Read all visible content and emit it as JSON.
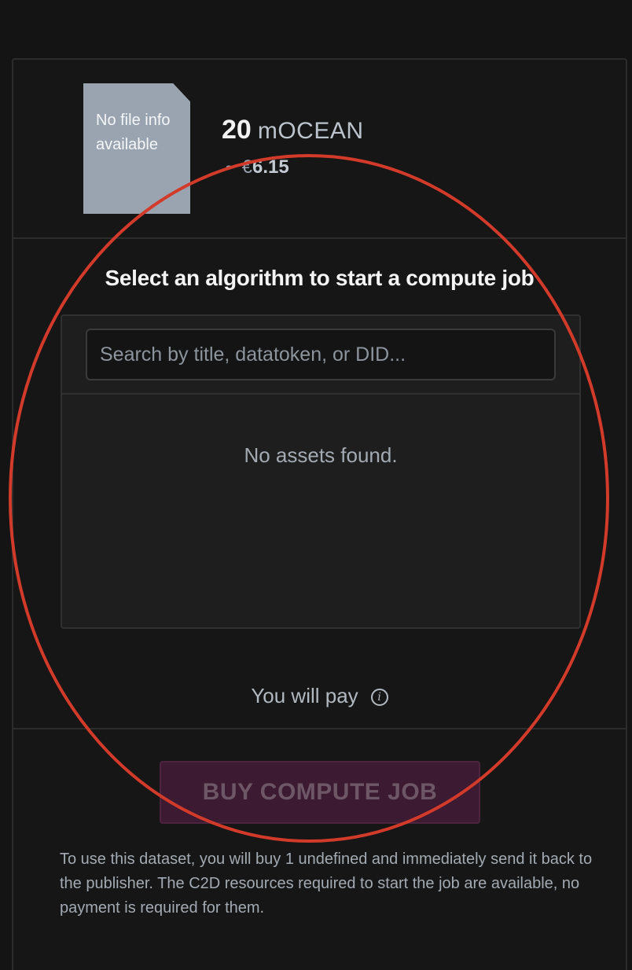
{
  "asset": {
    "file_info": "No file info available",
    "price_amount": "20",
    "price_symbol": "mOCEAN",
    "price_conversion_prefix": "~ €",
    "price_conversion_value": "6.15"
  },
  "compute": {
    "title": "Select an algorithm to start a compute job",
    "search_placeholder": "Search by title, datatoken, or DID...",
    "empty_message": "No assets found.",
    "pay_label": "You will pay",
    "info_icon": "info-icon",
    "buy_button_label": "BUY COMPUTE JOB",
    "disclaimer": "To use this dataset, you will buy 1 undefined and immediately send it back to the publisher. The C2D resources required to start the job are available, no payment is required for them."
  },
  "colors": {
    "background": "#141414",
    "file_icon": "#9aa4b1",
    "buy_button_disabled": "#3c1a32",
    "annotation_circle": "#d23a2a"
  }
}
